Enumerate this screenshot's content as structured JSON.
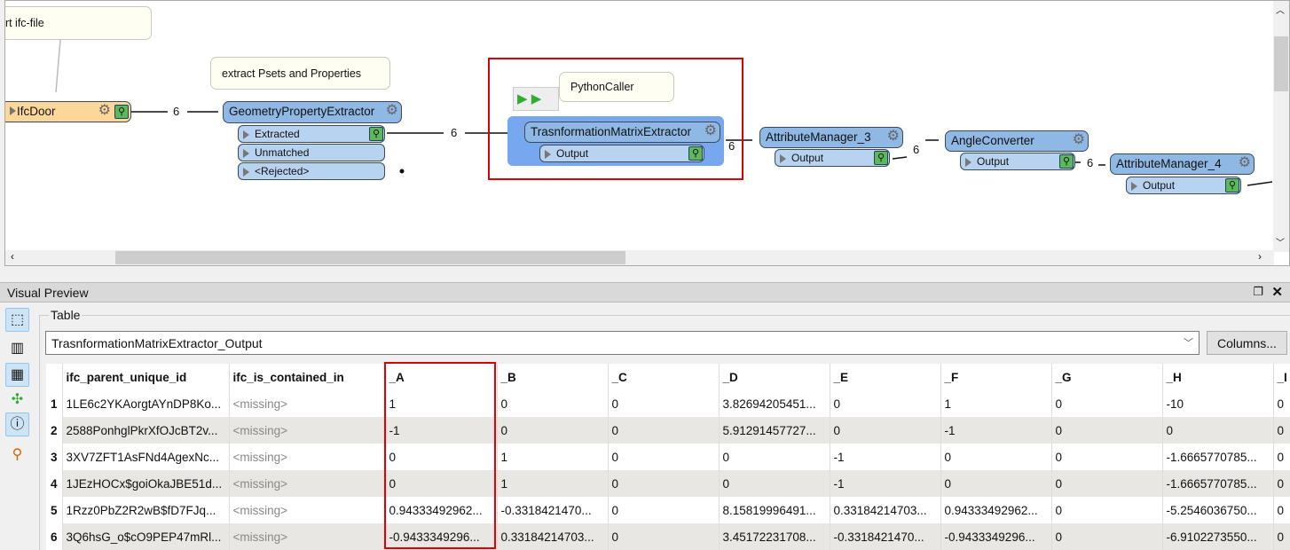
{
  "canvas": {
    "annotations": {
      "import": "ort ifc-file",
      "extract": "extract Psets and Properties",
      "python": "PythonCaller"
    },
    "nodes": {
      "ifcdoor": "IfcDoor",
      "gpe": {
        "title": "GeometryPropertyExtractor",
        "ports": [
          "Extracted",
          "Unmatched",
          "<Rejected>"
        ]
      },
      "tme": {
        "title": "TrasnformationMatrixExtractor",
        "port": "Output"
      },
      "am3": {
        "title": "AttributeManager_3",
        "port": "Output"
      },
      "ac": {
        "title": "AngleConverter",
        "port": "Output"
      },
      "am4": {
        "title": "AttributeManager_4",
        "port": "Output"
      }
    },
    "counts": [
      "6",
      "6",
      "6",
      "6",
      "6"
    ],
    "highlight_color": "#e00000"
  },
  "preview": {
    "title": "Visual Preview",
    "group_label": "Table",
    "dataset": "TrasnformationMatrixExtractor_Output",
    "columns_button": "Columns...",
    "table": {
      "headers": [
        "ifc_parent_unique_id",
        "ifc_is_contained_in",
        "_A",
        "_B",
        "_C",
        "_D",
        "_E",
        "_F",
        "_G",
        "_H",
        "_I"
      ],
      "rows": [
        [
          "1",
          "1LE6c2YKAorgtAYnDP8Ko...",
          "<missing>",
          "1",
          "0",
          "0",
          "3.82694205451...",
          "0",
          "1",
          "0",
          "-10",
          "0"
        ],
        [
          "2",
          "2588PonhglPkrXfOJcBT2v...",
          "<missing>",
          "-1",
          "0",
          "0",
          "5.91291457727...",
          "0",
          "-1",
          "0",
          "0",
          "0"
        ],
        [
          "3",
          "3XV7ZFT1AsFNd4AgexNc...",
          "<missing>",
          "0",
          "1",
          "0",
          "0",
          "-1",
          "0",
          "0",
          "-1.6665770785...",
          "0"
        ],
        [
          "4",
          "1JEzHOCx$goiOkaJBE51d...",
          "<missing>",
          "0",
          "1",
          "0",
          "0",
          "-1",
          "0",
          "0",
          "-1.6665770785...",
          "0"
        ],
        [
          "5",
          "1Rzz0PbZ2R2wB$fD7FJq...",
          "<missing>",
          "0.94333492962...",
          "-0.3318421470...",
          "0",
          "8.15819996491...",
          "0.33184214703...",
          "0.94333492962...",
          "0",
          "-5.2546036750...",
          "0"
        ],
        [
          "6",
          "3Q6hsG_o$cO9PEP47mRl...",
          "<missing>",
          "-0.9433349296...",
          "0.33184214703...",
          "0",
          "3.45172231708...",
          "-0.3318421470...",
          "-0.9433349296...",
          "0",
          "-6.9102273550...",
          "0"
        ]
      ]
    }
  }
}
